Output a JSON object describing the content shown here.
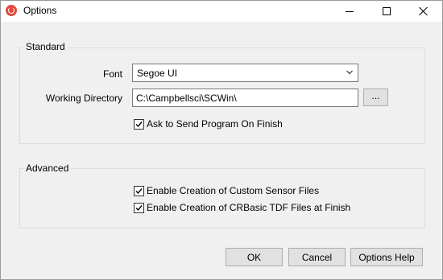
{
  "window": {
    "title": "Options"
  },
  "standard": {
    "group_label": "Standard",
    "font_label": "Font",
    "font_value": "Segoe UI",
    "directory_label": "Working Directory",
    "directory_value": "C:\\Campbellsci\\SCWin\\",
    "browse_label": "...",
    "ask_send_label": "Ask to Send Program On Finish",
    "ask_send_checked": true
  },
  "advanced": {
    "group_label": "Advanced",
    "custom_sensor_label": "Enable Creation of Custom Sensor Files",
    "custom_sensor_checked": true,
    "crbasic_tdf_label": "Enable Creation of CRBasic TDF Files at Finish",
    "crbasic_tdf_checked": true
  },
  "buttons": {
    "ok": "OK",
    "cancel": "Cancel",
    "help": "Options Help"
  },
  "icons": {
    "app": "app-icon",
    "chevron": "chevron-down-icon",
    "check": "checkmark-icon"
  },
  "colors": {
    "app_icon": "#e14b3c",
    "dialog_bg": "#f0f0f0",
    "button_bg": "#e1e1e1"
  }
}
